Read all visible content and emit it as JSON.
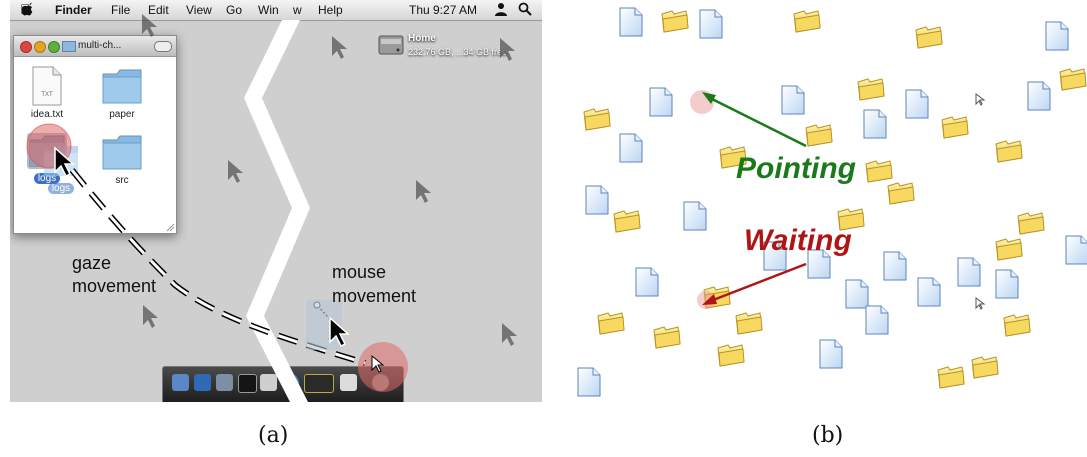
{
  "panel_a": {
    "menubar": {
      "finder": "Finder",
      "file": "File",
      "edit": "Edit",
      "view": "View",
      "go": "Go",
      "window": "Win",
      "window_b": "w",
      "help": "Help",
      "clock": "Thu 9:27 AM"
    },
    "finder_window": {
      "title": "multi-ch...",
      "files": [
        "idea.txt",
        "paper",
        "logs",
        "src"
      ],
      "ghost_label": "logs",
      "txt_badge": "TXT"
    },
    "home_drive": {
      "label": "Home",
      "detail": "232.76 GB, ...34 GB free"
    },
    "gaze_label_1": "gaze",
    "gaze_label_2": "movement",
    "mouse_label_1": "mouse",
    "mouse_label_2": "movement",
    "caption": "(a)"
  },
  "panel_b": {
    "pointing_label": "Pointing",
    "waiting_label": "Waiting",
    "caption": "(b)",
    "colors": {
      "pointing": "#1a7a1a",
      "waiting": "#b01515",
      "folder": "#f4d35a",
      "document": "#cfe2f7"
    }
  }
}
